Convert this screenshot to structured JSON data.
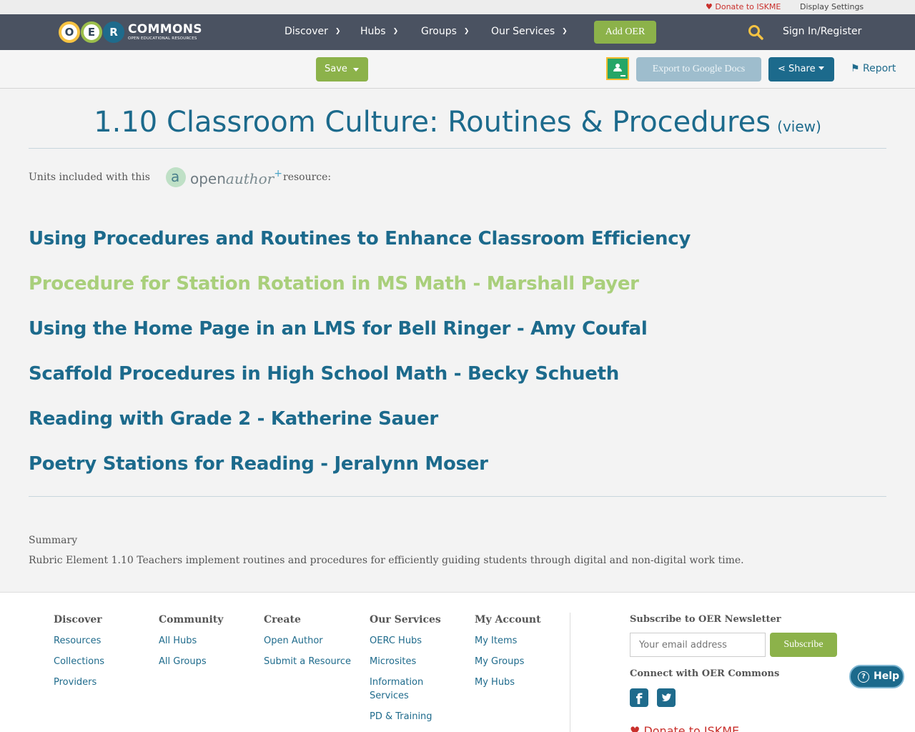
{
  "utility": {
    "donate": "Donate to ISKME",
    "display_settings": "Display Settings"
  },
  "nav": {
    "logo_letters": [
      "O",
      "E",
      "R"
    ],
    "logo_title": "COMMONS",
    "logo_subtitle": "OPEN EDUCATIONAL RESOURCES",
    "items": [
      "Discover",
      "Hubs",
      "Groups",
      "Our Services"
    ],
    "add_oer": "Add OER",
    "sign_in": "Sign In/Register"
  },
  "actions": {
    "save": "Save",
    "export": "Export to Google Docs",
    "share": "Share",
    "report": "Report"
  },
  "page": {
    "title": "1.10 Classroom Culture: Routines & Procedures",
    "view_link": "(view)",
    "units_prefix": "Units included with this",
    "openauthor": {
      "open": "open",
      "author": "author",
      "plus": "+"
    },
    "units_suffix": "resource:",
    "units": [
      "Using Procedures and Routines to Enhance Classroom Efficiency",
      "Procedure for Station Rotation in MS Math - Marshall Payer",
      "Using the Home Page in an LMS for Bell Ringer - Amy Coufal",
      "Scaffold Procedures in High School Math - Becky Schueth",
      "Reading with Grade 2 - Katherine Sauer",
      "Poetry Stations for Reading - Jeralynn Moser"
    ],
    "active_unit_index": 1,
    "summary_label": "Summary",
    "summary_text": "Rubric Element 1.10 Teachers implement routines and procedures for efficiently guiding students through digital and non-digital work time."
  },
  "footer": {
    "columns": [
      {
        "heading": "Discover",
        "links": [
          "Resources",
          "Collections",
          "Providers"
        ]
      },
      {
        "heading": "Community",
        "links": [
          "All Hubs",
          "All Groups"
        ]
      },
      {
        "heading": "Create",
        "links": [
          "Open Author",
          "Submit a Resource"
        ]
      },
      {
        "heading": "Our Services",
        "links": [
          "OERC Hubs",
          "Microsites",
          "Information Services",
          "PD & Training"
        ]
      },
      {
        "heading": "My Account",
        "links": [
          "My Items",
          "My Groups",
          "My Hubs"
        ]
      }
    ],
    "newsletter_heading": "Subscribe to OER Newsletter",
    "email_placeholder": "Your email address",
    "subscribe": "Subscribe",
    "connect_heading": "Connect with OER Commons",
    "donate": "Donate to ISKME"
  },
  "help": "Help",
  "colors": {
    "nav_bg": "#4a5261",
    "accent_green": "#8cb24a",
    "link_blue": "#1c6a8c",
    "active_unit": "#a9cf7b",
    "donate_red": "#c9302c"
  }
}
